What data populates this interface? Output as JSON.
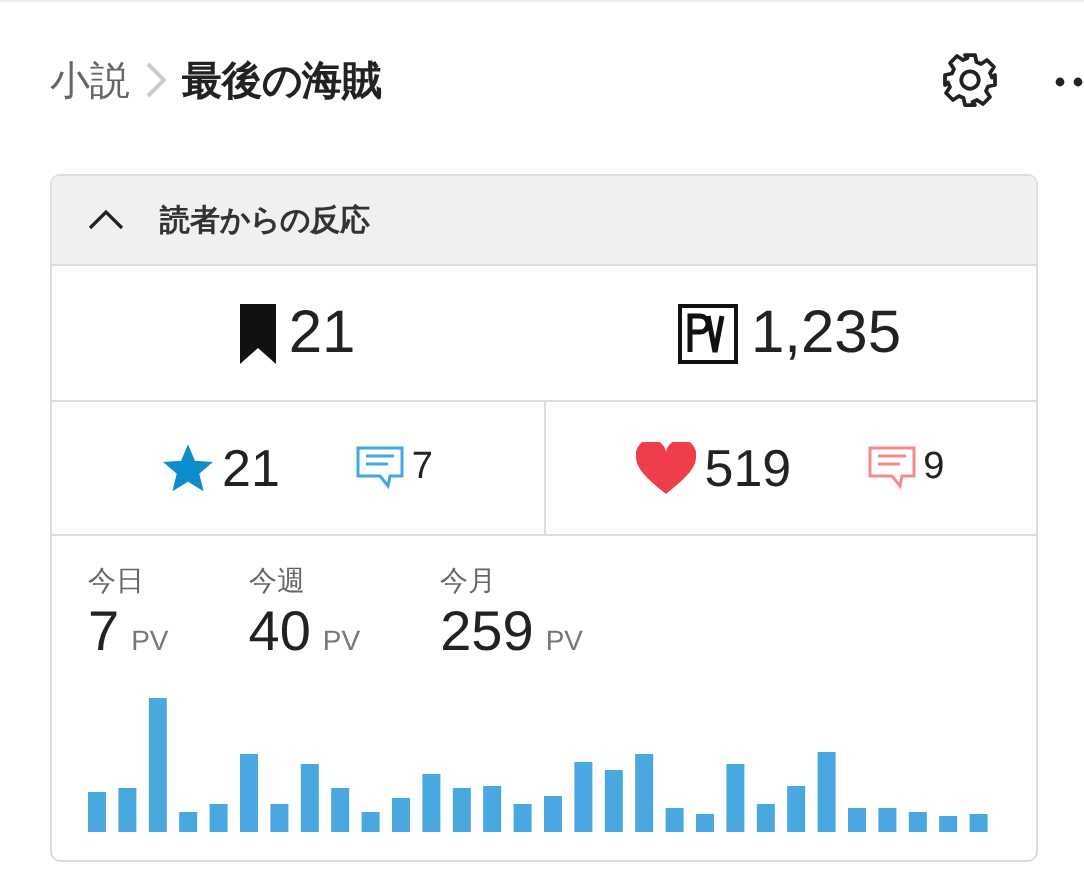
{
  "breadcrumb": {
    "parent": "小説",
    "current": "最後の海賊"
  },
  "panel": {
    "title": "読者からの反応",
    "expanded": true,
    "totals": [
      {
        "kind": "bookmark",
        "value": "21"
      },
      {
        "kind": "pv",
        "value": "1,235"
      }
    ],
    "reactions": [
      {
        "kind": "star",
        "value": "21",
        "comments": "7",
        "color": "#3fa9e0"
      },
      {
        "kind": "heart",
        "value": "519",
        "comments": "9",
        "color": "#f58a8a"
      }
    ],
    "periods": [
      {
        "label": "今日",
        "value": "7",
        "unit": "PV"
      },
      {
        "label": "今週",
        "value": "40",
        "unit": "PV"
      },
      {
        "label": "今月",
        "value": "259",
        "unit": "PV"
      }
    ]
  }
}
